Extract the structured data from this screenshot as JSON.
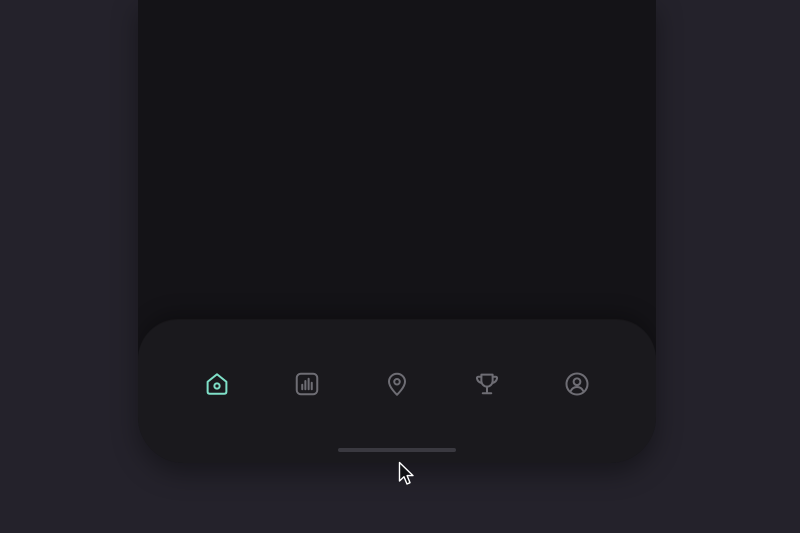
{
  "colors": {
    "background": "#24222b",
    "phone_screen": "#141317",
    "tab_bar": "#1a191d",
    "active_icon": "#7fe0c8",
    "inactive_icon": "#6e6d74",
    "home_indicator": "#3a3940"
  },
  "tab_bar": {
    "tabs": [
      {
        "icon": "home-icon",
        "active": true
      },
      {
        "icon": "bar-chart-icon",
        "active": false
      },
      {
        "icon": "map-pin-icon",
        "active": false
      },
      {
        "icon": "trophy-icon",
        "active": false
      },
      {
        "icon": "user-circle-icon",
        "active": false
      }
    ]
  },
  "cursor": {
    "icon": "arrow-cursor-icon"
  }
}
